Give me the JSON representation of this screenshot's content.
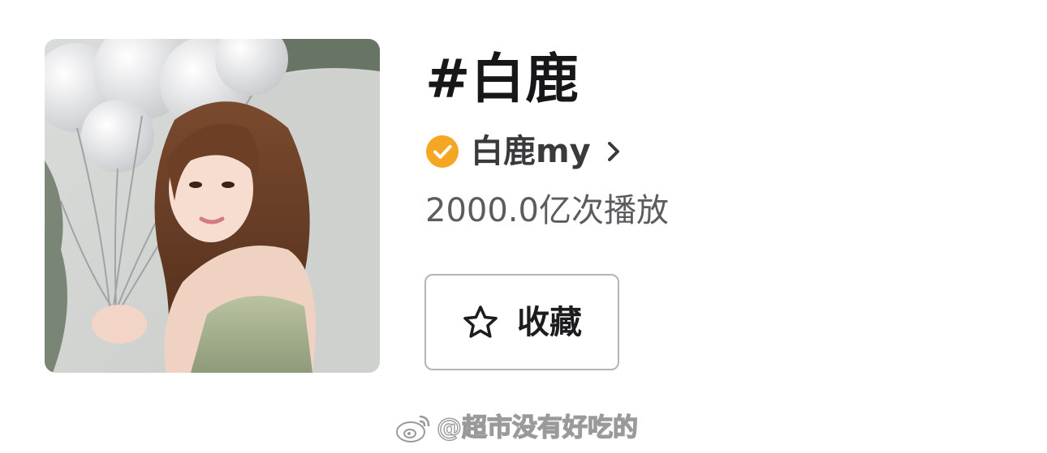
{
  "topic": {
    "title": "#白鹿",
    "author_name": "白鹿my",
    "play_count": "2000.0亿次播放",
    "favorite_label": "收藏"
  },
  "icons": {
    "verified": "verified-check-icon",
    "chevron": "chevron-right-icon",
    "favorite": "star-outline-icon",
    "watermark_logo": "weibo-logo-icon"
  },
  "watermark": {
    "text": "@超市没有好吃的"
  },
  "colors": {
    "verified_badge": "#f5a623",
    "title_text": "#17171a",
    "secondary_text": "#5c5c60",
    "button_border": "#b4b4b8"
  }
}
